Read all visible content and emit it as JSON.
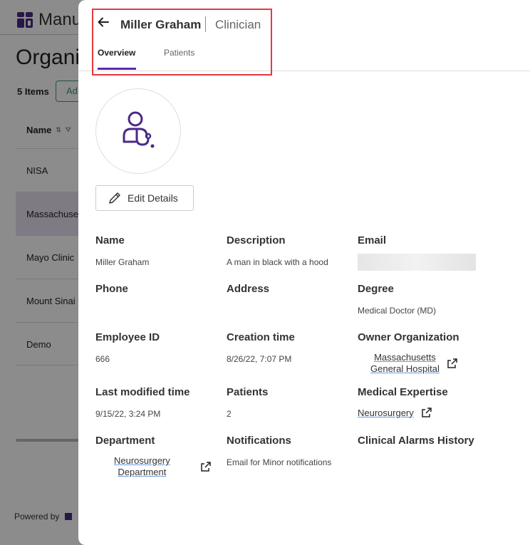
{
  "background": {
    "brand": "Manu",
    "title": "Organi",
    "items_count": "5 Items",
    "add_button": "Ad",
    "column_header": "Name",
    "rows": [
      "NISA",
      "Massachuse",
      "Mayo Clinic",
      "Mount Sinai",
      "Demo"
    ],
    "powered_by": "Powered by"
  },
  "header": {
    "name": "Miller Graham",
    "role": "Clinician",
    "tabs": {
      "overview": "Overview",
      "patients": "Patients"
    }
  },
  "edit_button": "Edit Details",
  "fields": {
    "name": {
      "label": "Name",
      "value": "Miller Graham"
    },
    "description": {
      "label": "Description",
      "value": "A man in black with a hood"
    },
    "email": {
      "label": "Email",
      "value": ""
    },
    "phone": {
      "label": "Phone",
      "value": ""
    },
    "address": {
      "label": "Address",
      "value": ""
    },
    "degree": {
      "label": "Degree",
      "value": "Medical Doctor (MD)"
    },
    "employee_id": {
      "label": "Employee ID",
      "value": "666"
    },
    "creation_time": {
      "label": "Creation time",
      "value": "8/26/22, 7:07 PM"
    },
    "owner_org": {
      "label": "Owner Organization",
      "line1": "Massachusetts",
      "line2": "General Hospital"
    },
    "last_modified": {
      "label": "Last modified time",
      "value": "9/15/22, 3:24 PM"
    },
    "patients": {
      "label": "Patients",
      "value": "2"
    },
    "expertise": {
      "label": "Medical Expertise",
      "value": "Neurosurgery"
    },
    "department": {
      "label": "Department",
      "line1": "Neurosurgery",
      "line2": "Department"
    },
    "notifications": {
      "label": "Notifications",
      "value": "Email for Minor notifications"
    },
    "alarms": {
      "label": "Clinical Alarms History",
      "value": ""
    }
  },
  "colors": {
    "accent": "#5b2bb0",
    "highlight": "#e8373e",
    "icon": "#4a2a86"
  },
  "icons": {
    "back": "arrow-left-icon",
    "avatar": "clinician-icon",
    "edit": "pencil-icon",
    "external": "external-link-icon"
  }
}
